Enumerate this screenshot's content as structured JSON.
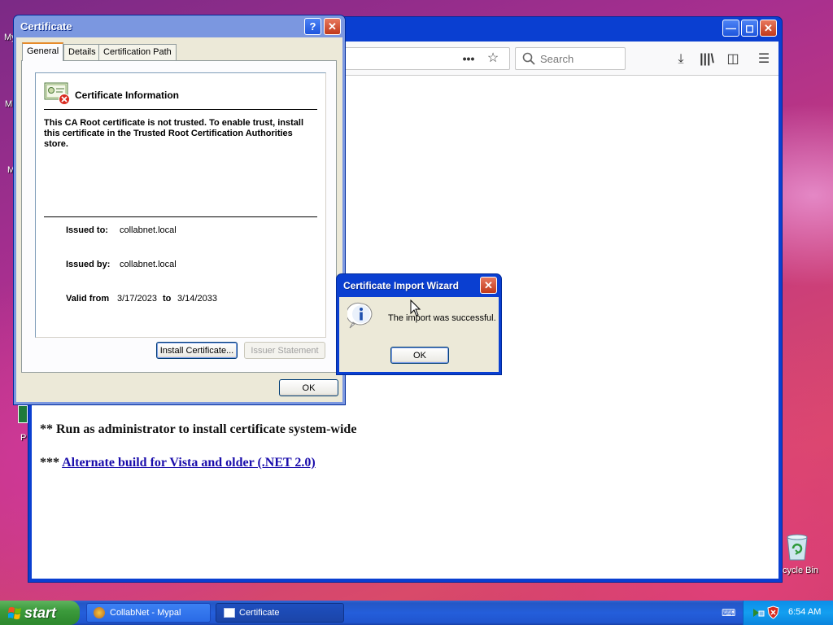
{
  "desktop": {
    "icon_labels": [
      "My",
      "M",
      "M",
      "P"
    ],
    "recycle_bin": "cycle Bin"
  },
  "browser": {
    "search_placeholder": "Search",
    "page_text": {
      "line1": "** Run as administrator to install certificate system-wide",
      "line2_prefix": "*** ",
      "line2_link": "Alternate build for Vista and older (.NET 2.0)"
    }
  },
  "cert_dialog": {
    "title": "Certificate",
    "help_button": "?",
    "tabs": [
      "General",
      "Details",
      "Certification Path"
    ],
    "info_title": "Certificate Information",
    "info_text": "This CA Root certificate is not trusted. To enable trust, install this certificate in the Trusted Root Certification Authorities store.",
    "issued_to_label": "Issued to:",
    "issued_to_value": "collabnet.local",
    "issued_by_label": "Issued by:",
    "issued_by_value": "collabnet.local",
    "valid_from_label": "Valid from",
    "valid_from_value": "3/17/2023",
    "to_label": "to",
    "valid_to_value": "3/14/2033",
    "install_button": "Install Certificate...",
    "issuer_button": "Issuer Statement",
    "ok_button": "OK"
  },
  "wizard": {
    "title": "Certificate Import Wizard",
    "message": "The import was successful.",
    "ok_button": "OK"
  },
  "taskbar": {
    "start_label": "start",
    "tasks": [
      "CollabNet - Mypal",
      "Certificate"
    ],
    "clock": "6:54 AM"
  },
  "colors": {
    "xp_title_blue": "#0a3fd1",
    "dialog_face": "#ece9d8",
    "link": "#1a0dab",
    "taskbar": "#245edb",
    "start_green": "#3c9b3c"
  }
}
